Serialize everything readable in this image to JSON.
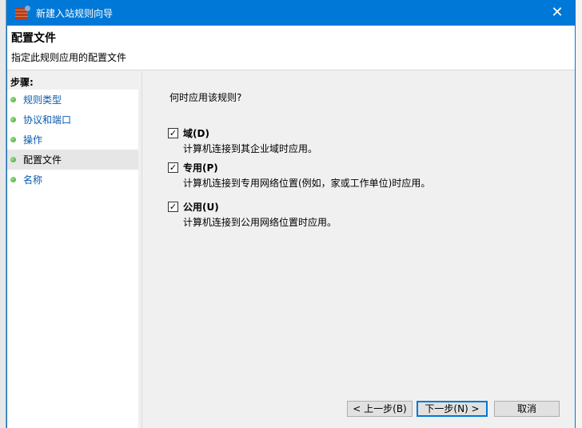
{
  "window": {
    "title": "新建入站规则向导",
    "close_icon": "close-icon"
  },
  "header": {
    "title": "配置文件",
    "subtitle": "指定此规则应用的配置文件"
  },
  "steps": {
    "heading": "步骤:",
    "items": [
      {
        "label": "规则类型"
      },
      {
        "label": "协议和端口"
      },
      {
        "label": "操作"
      },
      {
        "label": "配置文件",
        "active": true
      },
      {
        "label": "名称"
      }
    ]
  },
  "main": {
    "question": "何时应用该规则?",
    "options": [
      {
        "label": "域(D)",
        "desc": "计算机连接到其企业域时应用。",
        "checked": true
      },
      {
        "label": "专用(P)",
        "desc": "计算机连接到专用网络位置(例如，家或工作单位)时应用。",
        "checked": true
      },
      {
        "label": "公用(U)",
        "desc": "计算机连接到公用网络位置时应用。",
        "checked": true
      }
    ]
  },
  "buttons": {
    "back": "< 上一步(B)",
    "next": "下一步(N) >",
    "cancel": "取消"
  },
  "colors": {
    "accent": "#0078d7"
  }
}
